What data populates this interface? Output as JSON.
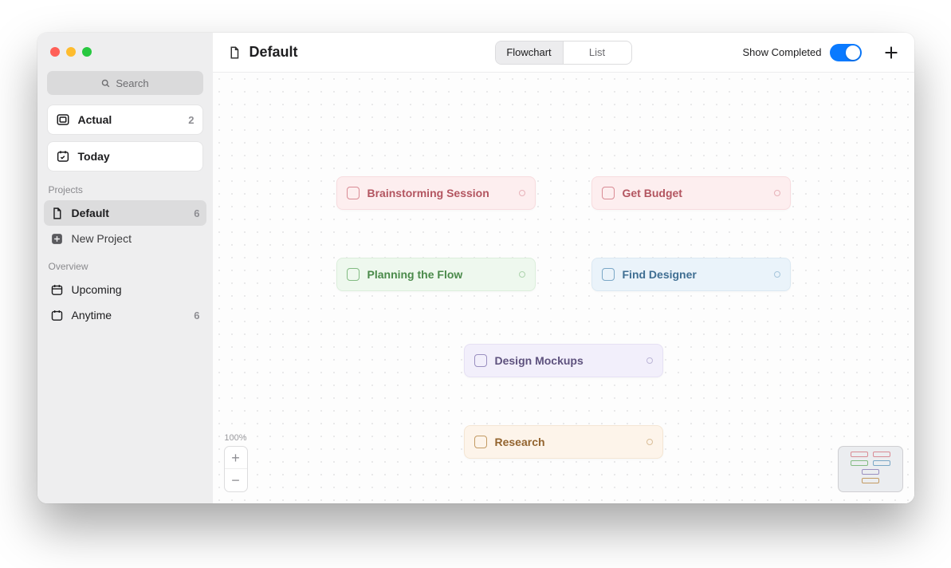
{
  "search_placeholder": "Search",
  "sidebar": {
    "actual": {
      "label": "Actual",
      "count": "2"
    },
    "today": {
      "label": "Today"
    },
    "projects_label": "Projects",
    "projects": [
      {
        "label": "Default",
        "count": "6",
        "selected": true
      }
    ],
    "new_project": "New Project",
    "overview_label": "Overview",
    "overview": {
      "upcoming": {
        "label": "Upcoming"
      },
      "anytime": {
        "label": "Anytime",
        "count": "6"
      }
    }
  },
  "header": {
    "title": "Default",
    "view_flowchart": "Flowchart",
    "view_list": "List",
    "show_completed": "Show Completed"
  },
  "zoom": {
    "level": "100%"
  },
  "nodes": {
    "brainstorm": "Brainstorming Session",
    "budget": "Get Budget",
    "planning": "Planning the Flow",
    "designer": "Find Designer",
    "mockups": "Design Mockups",
    "research": "Research"
  }
}
